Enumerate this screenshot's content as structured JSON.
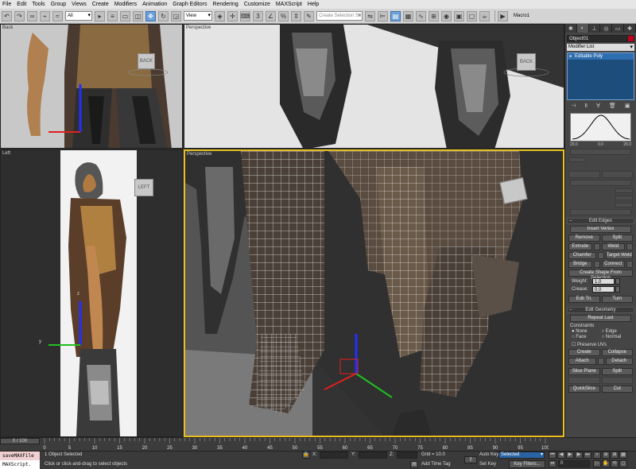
{
  "menu": [
    "File",
    "Edit",
    "Tools",
    "Group",
    "Views",
    "Create",
    "Modifiers",
    "Animation",
    "Graph Editors",
    "Rendering",
    "Customize",
    "MAXScript",
    "Help"
  ],
  "toolbar": {
    "filter_value": "All",
    "refcoord_value": "View",
    "named_selection_placeholder": "Create Selection Se",
    "macro_label": "Macro1"
  },
  "viewports": {
    "top_left_label": "Back",
    "top_right_label": "Perspective",
    "bottom_left_label": "Left",
    "bottom_right_label": "Perspective",
    "cube_back": "BACK",
    "cube_left": "LEFT",
    "axis_y": "y",
    "axis_z": "z"
  },
  "command_panel": {
    "object_name": "Object01",
    "object_color": "#c4001f",
    "modifier_list_label": "Modifier List",
    "stack_item": "Editable Poly",
    "falloff_left": "20.0",
    "falloff_mid": "0.0",
    "falloff_right": "20.0",
    "edit_edges": {
      "title": "Edit Edges",
      "insert_vertex": "Insert Vertex",
      "remove": "Remove",
      "split": "Split",
      "extrude": "Extrude",
      "weld": "Weld",
      "chamfer": "Chamfer",
      "target_weld": "Target Weld",
      "bridge": "Bridge",
      "connect": "Connect",
      "create_shape": "Create Shape From Selection",
      "weight_label": "Weight:",
      "weight_value": "1.0",
      "crease_label": "Crease:",
      "crease_value": "0.0",
      "edit_tri": "Edit Tri.",
      "turn": "Turn"
    },
    "edit_geometry": {
      "title": "Edit Geometry",
      "repeat_last": "Repeat Last",
      "constraints_label": "Constraints",
      "none": "None",
      "edge": "Edge",
      "face": "Face",
      "normal": "Normal",
      "preserve_uvs": "Preserve UVs",
      "create": "Create",
      "collapse": "Collapse",
      "attach": "Attach",
      "detach": "Detach",
      "slice_plane": "Slice Plane",
      "split": "Split",
      "quickslice": "QuickSlice",
      "cut": "Cut"
    }
  },
  "timeline": {
    "frame_counter": "0 / 100",
    "ticks": [
      "0",
      "5",
      "10",
      "15",
      "20",
      "25",
      "30",
      "35",
      "40",
      "45",
      "50",
      "55",
      "60",
      "65",
      "70",
      "75",
      "80",
      "85",
      "90",
      "95",
      "100"
    ]
  },
  "status": {
    "maxscript_line1": "saveMAXFile",
    "maxscript_line2": "MAXScript.",
    "selected_count": "1 Object Selected",
    "prompt": "Click or click-and-drag to select objects",
    "x_label": "X:",
    "y_label": "Y:",
    "z_label": "Z:",
    "grid": "Grid = 10.0",
    "add_time_tag": "Add Time Tag",
    "auto_key": "Auto Key",
    "set_key": "Set Key",
    "key_mode_value": "Selected",
    "key_filters": "Key Filters...",
    "frame_value": "0"
  }
}
